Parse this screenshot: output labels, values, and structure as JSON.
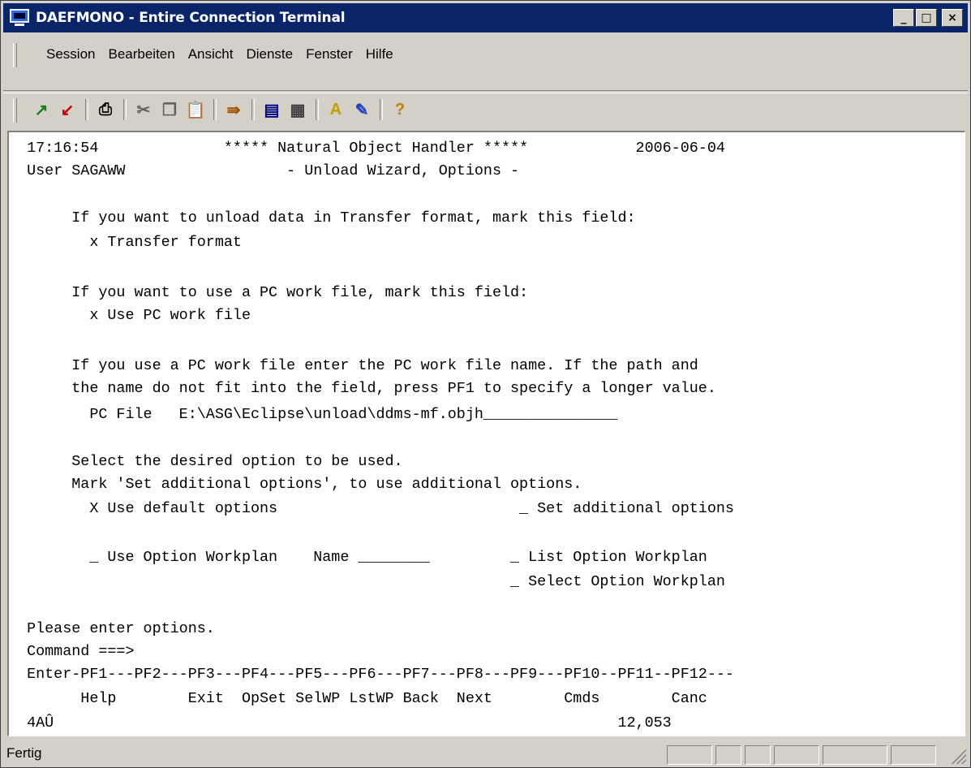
{
  "window": {
    "title": "DAEFMONO - Entire Connection Terminal",
    "controls": {
      "minimize": "_",
      "maximize": "□",
      "close": "×"
    }
  },
  "menubar": [
    "Session",
    "Bearbeiten",
    "Ansicht",
    "Dienste",
    "Fenster",
    "Hilfe"
  ],
  "toolbar": {
    "icons": [
      {
        "name": "connect-icon",
        "glyph": "↗",
        "color": "#1a7a1a"
      },
      {
        "name": "disconnect-icon",
        "glyph": "↙",
        "color": "#c00000"
      },
      {
        "name": "print-icon",
        "glyph": "⎙",
        "color": "#000000"
      },
      {
        "name": "cut-icon",
        "glyph": "✂",
        "color": "#606060"
      },
      {
        "name": "copy-icon",
        "glyph": "❐",
        "color": "#606060"
      },
      {
        "name": "paste-icon",
        "glyph": "📋",
        "color": "#604000"
      },
      {
        "name": "transfer-icon",
        "glyph": "⇛",
        "color": "#a05000"
      },
      {
        "name": "screen-icon",
        "glyph": "▤",
        "color": "#000080"
      },
      {
        "name": "record-icon",
        "glyph": "▦",
        "color": "#404040"
      },
      {
        "name": "font-icon",
        "glyph": "A",
        "color": "#c0a000"
      },
      {
        "name": "color-icon",
        "glyph": "✎",
        "color": "#2040c0"
      },
      {
        "name": "help-icon",
        "glyph": "?",
        "color": "#c08000"
      }
    ]
  },
  "terminal": {
    "lines": [
      "  17:16:54              ***** Natural Object Handler *****            2006-06-04",
      "  User SAGAWW                  - Unload Wizard, Options -",
      "",
      "       If you want to unload data in Transfer format, mark this field:",
      "         x Transfer format",
      "",
      "       If you want to use a PC work file, mark this field:",
      "         x Use PC work file",
      "",
      "       If you use a PC work file enter the PC work file name. If the path and",
      "       the name do not fit into the field, press PF1 to specify a longer value.",
      "         PC File   E:\\ASG\\Eclipse\\unload\\ddms-mf.objh_______________",
      "",
      "       Select the desired option to be used.",
      "       Mark 'Set additional options', to use additional options.",
      "         X Use default options                           _ Set additional options",
      "",
      "         _ Use Option Workplan    Name ________         _ List Option Workplan",
      "                                                        _ Select Option Workplan",
      "",
      "  Please enter options.",
      "  Command ===>",
      "  Enter-PF1---PF2---PF3---PF4---PF5---PF6---PF7---PF8---PF9---PF10--PF11--PF12---",
      "        Help        Exit  OpSet SelWP LstWP Back  Next        Cmds        Canc",
      "  4AÛ                                                               12,053"
    ]
  },
  "statusbar": {
    "text": "Fertig"
  }
}
